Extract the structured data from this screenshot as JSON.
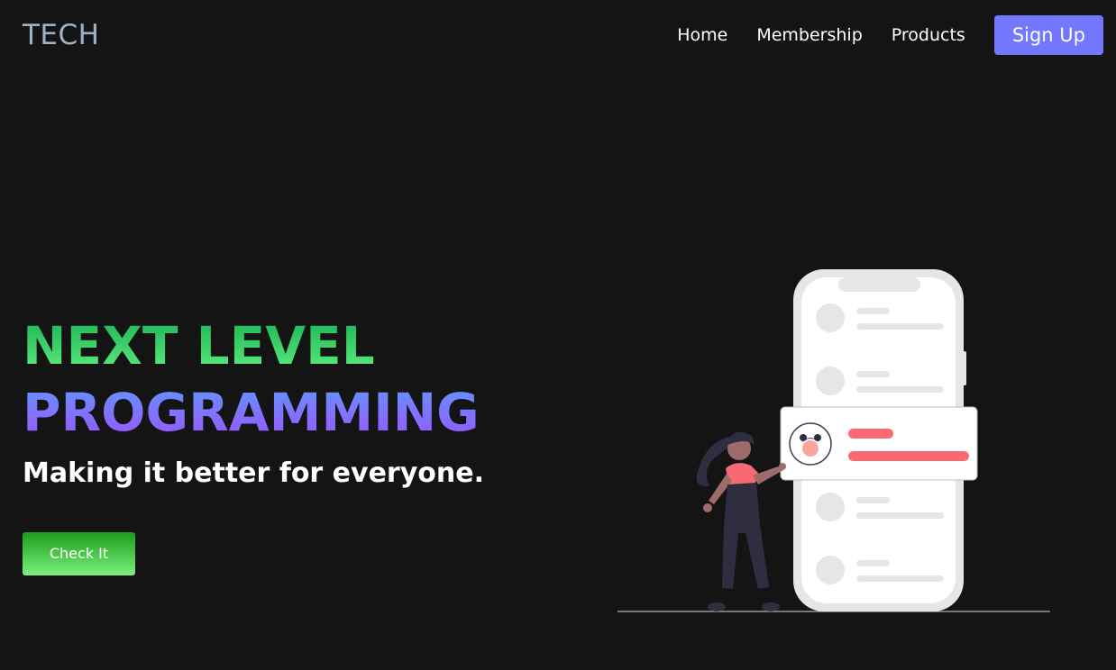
{
  "navbar": {
    "logo": "TECH",
    "links": [
      "Home",
      "Membership",
      "Products"
    ],
    "signup_label": "Sign Up"
  },
  "hero": {
    "title_line1": "NEXT LEVEL",
    "title_line2": "PROGRAMMING",
    "subtitle": "Making it better for everyone.",
    "cta_label": "Check It"
  },
  "colors": {
    "background": "#141414",
    "accent": "#7477ff",
    "green": "#1bb155",
    "purple": "#a14cff",
    "highlight": "#f86a72"
  }
}
